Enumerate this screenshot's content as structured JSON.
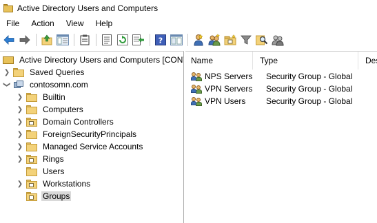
{
  "window": {
    "title": "Active Directory Users and Computers"
  },
  "menu": {
    "items": [
      "File",
      "Action",
      "View",
      "Help"
    ]
  },
  "toolbar": {
    "buttons": [
      "back-icon",
      "forward-icon",
      "up-folder-icon",
      "show-hide-tree-icon",
      "clipboard-icon",
      "properties-icon",
      "refresh-icon",
      "export-list-icon",
      "help-icon",
      "console-tree-icon",
      "new-user-icon",
      "new-group-icon",
      "new-ou-icon",
      "filter-icon",
      "find-icon",
      "delegate-icon"
    ]
  },
  "tree": {
    "root": "Active Directory Users and Computers [CONT",
    "saved_queries": "Saved Queries",
    "domain": "contosomn.com",
    "items": [
      {
        "label": "Builtin",
        "type": "folder",
        "expandable": true
      },
      {
        "label": "Computers",
        "type": "folder",
        "expandable": true
      },
      {
        "label": "Domain Controllers",
        "type": "ou",
        "expandable": true
      },
      {
        "label": "ForeignSecurityPrincipals",
        "type": "folder",
        "expandable": true
      },
      {
        "label": "Managed Service Accounts",
        "type": "folder",
        "expandable": true
      },
      {
        "label": "Rings",
        "type": "ou",
        "expandable": true
      },
      {
        "label": "Users",
        "type": "folder",
        "expandable": false
      },
      {
        "label": "Workstations",
        "type": "ou",
        "expandable": true
      },
      {
        "label": "Groups",
        "type": "ou",
        "expandable": false,
        "selected": true
      }
    ]
  },
  "list": {
    "columns": [
      "Name",
      "Type",
      "Des"
    ],
    "rows": [
      {
        "name": "NPS Servers",
        "type": "Security Group - Global"
      },
      {
        "name": "VPN Servers",
        "type": "Security Group - Global"
      },
      {
        "name": "VPN Users",
        "type": "Security Group - Global"
      }
    ]
  }
}
